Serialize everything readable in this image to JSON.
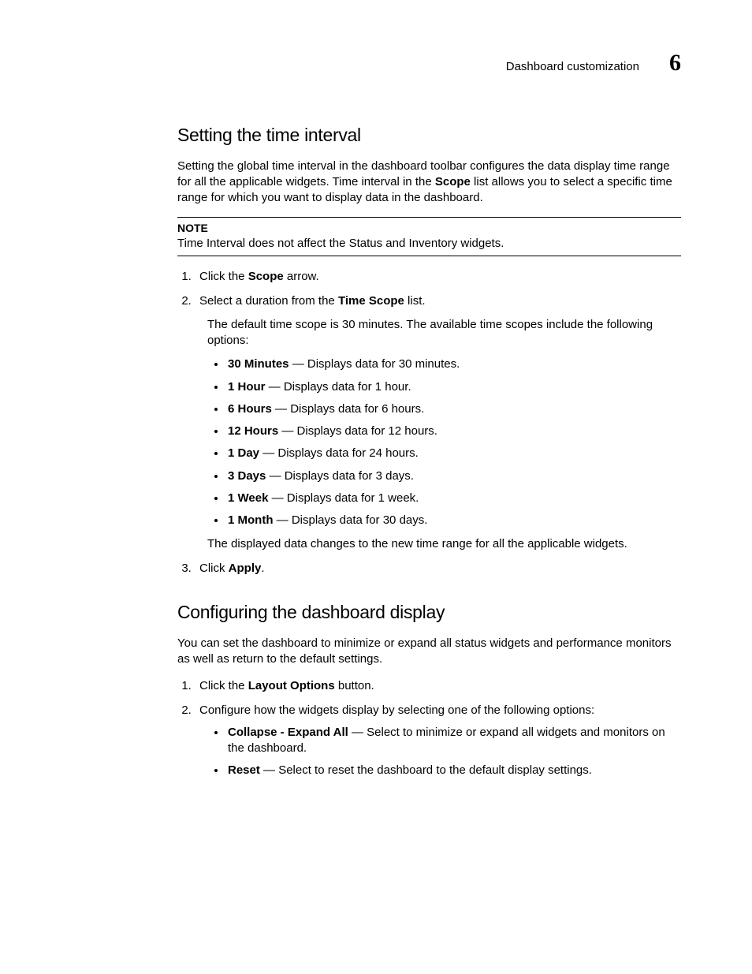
{
  "header": {
    "runningTitle": "Dashboard customization",
    "chapterNumber": "6"
  },
  "section1": {
    "heading": "Setting the time interval",
    "intro": {
      "pre": "Setting the global time interval in the dashboard toolbar configures the data display time range for all the applicable widgets. Time interval in the ",
      "bold": "Scope",
      "post": " list allows you to select a specific time range for which you want to display data in the dashboard."
    },
    "note": {
      "label": "NOTE",
      "text": "Time Interval does not affect the Status and Inventory widgets."
    },
    "step1": {
      "pre": "Click the ",
      "bold": "Scope",
      "post": " arrow."
    },
    "step2": {
      "pre": "Select a duration from the ",
      "bold": "Time Scope",
      "post": " list."
    },
    "step2sub": "The default time scope is 30 minutes. The available time scopes include the following options:",
    "scopes": [
      {
        "bold": "30 Minutes",
        "rest": " — Displays data for 30 minutes."
      },
      {
        "bold": "1 Hour",
        "rest": " — Displays data for 1 hour."
      },
      {
        "bold": "6 Hours",
        "rest": " — Displays data for 6 hours."
      },
      {
        "bold": "12 Hours",
        "rest": " — Displays data for 12 hours."
      },
      {
        "bold": "1 Day",
        "rest": " — Displays data for 24 hours."
      },
      {
        "bold": "3 Days",
        "rest": " — Displays data for 3 days."
      },
      {
        "bold": "1 Week",
        "rest": " — Displays data for 1 week."
      },
      {
        "bold": "1 Month",
        "rest": " — Displays data for 30 days."
      }
    ],
    "step2post": "The displayed data changes to the new time range for all the applicable widgets.",
    "step3": {
      "pre": "Click ",
      "bold": "Apply",
      "post": "."
    }
  },
  "section2": {
    "heading": "Configuring the dashboard display",
    "intro": "You can set the dashboard to minimize or expand all status widgets and performance monitors as well as return to the default settings.",
    "step1": {
      "pre": "Click the ",
      "bold": "Layout Options",
      "post": " button."
    },
    "step2": "Configure how the widgets display by selecting one of the following options:",
    "options": [
      {
        "bold": "Collapse - Expand All",
        "rest": " — Select to minimize or expand all widgets and monitors on the dashboard."
      },
      {
        "bold": "Reset",
        "rest": " — Select to reset the dashboard to the default display settings."
      }
    ]
  }
}
